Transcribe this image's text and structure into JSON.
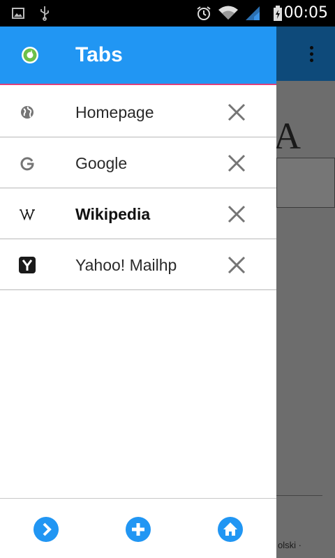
{
  "status_bar": {
    "time": "00:05",
    "icons": [
      "image-icon",
      "usb-icon",
      "alarm-icon",
      "wifi-icon",
      "signal-icon",
      "battery-icon"
    ]
  },
  "drawer": {
    "title": "Tabs",
    "tabs": [
      {
        "label": "Homepage",
        "icon": "globe-icon",
        "active": false
      },
      {
        "label": "Google",
        "icon": "google-icon",
        "active": false
      },
      {
        "label": "Wikipedia",
        "icon": "wikipedia-icon",
        "active": true
      },
      {
        "label": "Yahoo! Mailhp",
        "icon": "yahoo-icon",
        "active": false
      }
    ],
    "footer_buttons": [
      "forward-button",
      "new-tab-button",
      "home-button"
    ]
  },
  "background_page": {
    "letter": "A",
    "footer_text": "olski ·"
  },
  "colors": {
    "accent": "#2196f3",
    "header_underline": "#e0407a",
    "bg_toolbar": "#0e4a7a"
  }
}
